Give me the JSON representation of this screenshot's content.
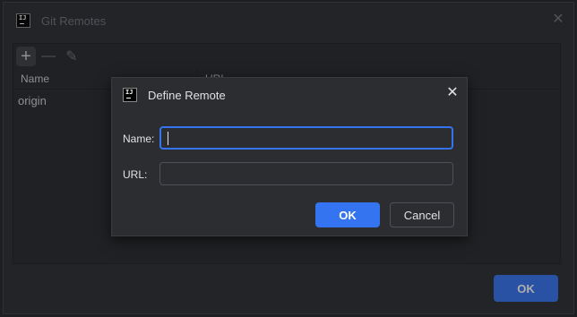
{
  "outer_window": {
    "title": "Git Remotes",
    "close_glyph": "✕",
    "icon_text": "IJ",
    "toolbar": {
      "add_glyph": "+",
      "remove_glyph": "—",
      "edit_glyph": "✎"
    },
    "table": {
      "columns": [
        "Name",
        "URL"
      ],
      "rows": [
        {
          "name": "origin"
        }
      ]
    },
    "ok_label": "OK"
  },
  "dialog": {
    "title": "Define Remote",
    "icon_text": "IJ",
    "close_glyph": "✕",
    "name_label": "Name:",
    "name_value": "",
    "url_label": "URL:",
    "url_value": "",
    "ok_label": "OK",
    "cancel_label": "Cancel"
  },
  "colors": {
    "accent": "#3574f0",
    "background": "#2b2d30"
  }
}
